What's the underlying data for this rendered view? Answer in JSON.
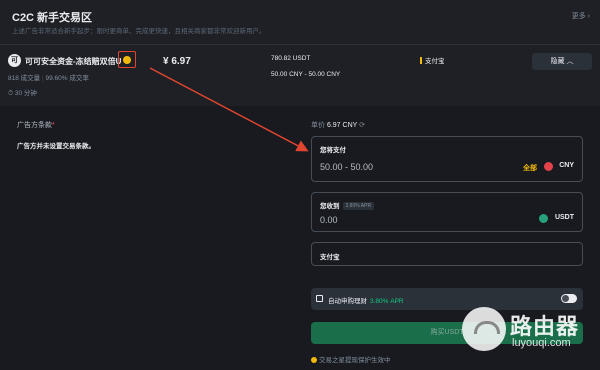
{
  "header": {
    "title": "C2C 新手交易区",
    "subtitle": "上述广告非常适合新手起步：限时更商单、完成更快速，且相关商家都非常欢迎新用户。",
    "more": "更多 ›"
  },
  "ad": {
    "avatar_letter": "可",
    "merchant_name": "可可安全资金-冻结赔双倍U",
    "orders": "818 成交量",
    "completion": "99.60% 成交率",
    "time": "30 分钟",
    "price": "¥ 6.97",
    "available": "780.82 USDT",
    "limit": "50.00 CNY - 50.00 CNY",
    "payment": "支付宝",
    "hide_label": "隐藏"
  },
  "terms": {
    "label": "广告方条款",
    "required_mark": "*",
    "text": "广告方并未设置交易条款。"
  },
  "order": {
    "unit_price_label": "单价",
    "unit_price_value": "6.97 CNY",
    "pay_label": "您将支付",
    "pay_value": "50.00 - 50.00",
    "all_label": "全部",
    "pay_currency": "CNY",
    "receive_label": "您收到",
    "receive_apr": "3.80% APR",
    "receive_value": "0.00",
    "receive_currency": "USDT",
    "payment_method": "支付宝",
    "auto_label": "自动申购理财",
    "auto_pct": "3.80% APR",
    "buy_label": "购买USDT",
    "protect_text": "交易之星提现保护生效中"
  },
  "watermark": {
    "main": "路由器",
    "url": "luyouqi.com"
  },
  "colors": {
    "accent": "#f0b90b",
    "annotation": "#e0462f",
    "buy_button": "#1a6e4a",
    "background": "#181a20"
  }
}
